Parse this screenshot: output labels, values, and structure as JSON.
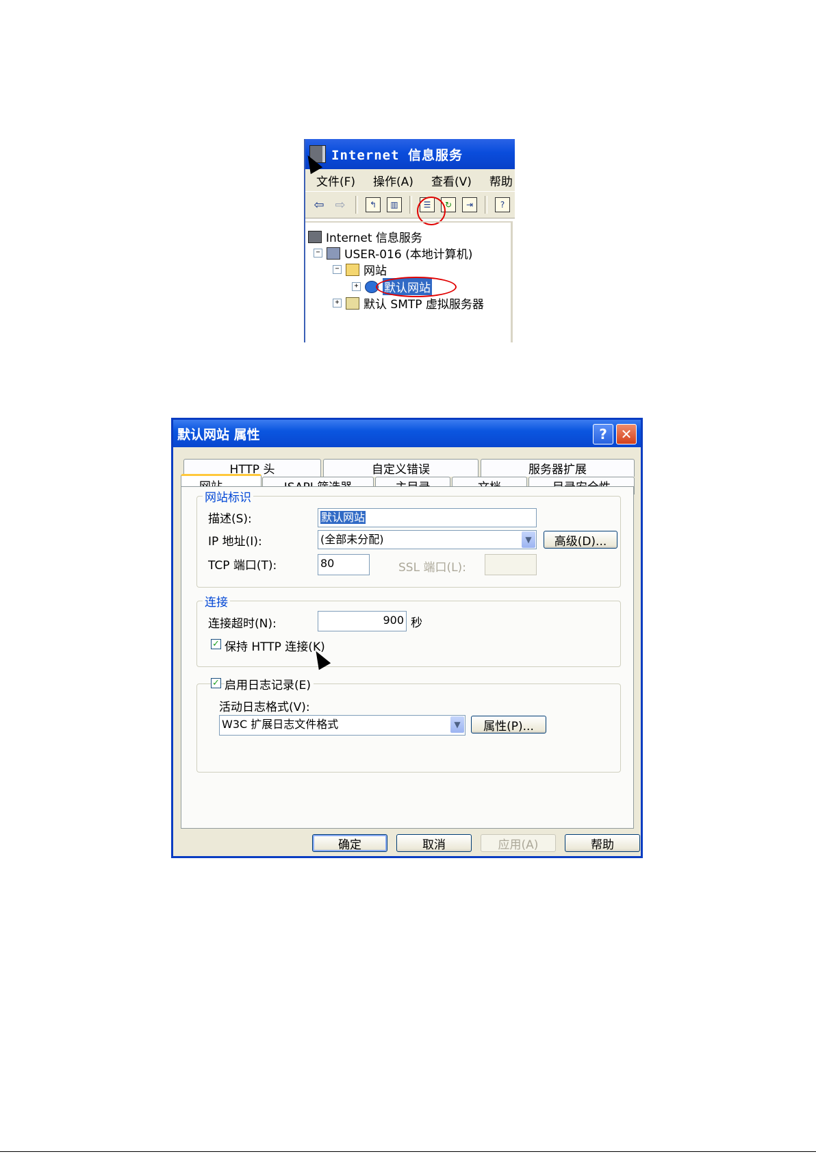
{
  "iis_window": {
    "title": "Internet 信息服务",
    "menu": [
      "文件(F)",
      "操作(A)",
      "查看(V)",
      "帮助"
    ],
    "toolbar_icons": [
      "back-arrow-icon",
      "forward-arrow-icon",
      "up-folder-icon",
      "show-hide-tree-icon",
      "properties-icon",
      "refresh-icon",
      "export-list-icon",
      "help-icon"
    ],
    "tree": {
      "root": "Internet 信息服务",
      "computer": "USER-016 (本地计算机)",
      "websites_folder": "网站",
      "default_site": "默认网站",
      "smtp": "默认 SMTP 虚拟服务器"
    }
  },
  "dialog": {
    "title": "默认网站 属性",
    "tabs_row1": [
      "HTTP 头",
      "自定义错误",
      "服务器扩展"
    ],
    "tabs_row2": [
      "网站",
      "ISAPI 筛选器",
      "主目录",
      "文档",
      "目录安全性"
    ],
    "active_tab": "网站",
    "site_identity": {
      "legend": "网站标识",
      "description_label": "描述(S):",
      "description_value": "默认网站",
      "ip_label": "IP 地址(I):",
      "ip_value": "(全部未分配)",
      "advanced_button": "高级(D)...",
      "tcp_label": "TCP 端口(T):",
      "tcp_value": "80",
      "ssl_label": "SSL 端口(L):",
      "ssl_value": ""
    },
    "connection": {
      "legend": "连接",
      "timeout_label": "连接超时(N):",
      "timeout_value": "900",
      "timeout_unit": "秒",
      "keepalive_label": "保持 HTTP 连接(K)",
      "keepalive_checked": true
    },
    "logging": {
      "enable_label": "启用日志记录(E)",
      "enable_checked": true,
      "format_label": "活动日志格式(V):",
      "format_value": "W3C 扩展日志文件格式",
      "properties_button": "属性(P)..."
    },
    "buttons": {
      "ok": "确定",
      "cancel": "取消",
      "apply": "应用(A)",
      "help": "帮助"
    }
  }
}
